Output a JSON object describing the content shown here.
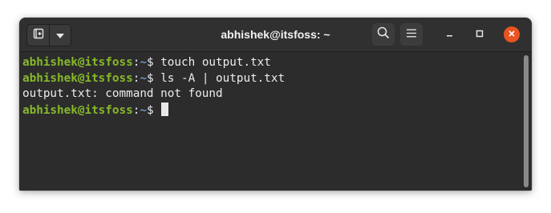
{
  "window": {
    "title": "abhishek@itsfoss: ~"
  },
  "icons": {
    "new_tab": "new-tab-icon",
    "menu_dropdown": "chevron-down-icon",
    "search": "search-icon",
    "hamburger": "hamburger-menu-icon",
    "minimize": "minimize-icon",
    "maximize": "maximize-icon",
    "close": "close-icon"
  },
  "colors": {
    "prompt_user": "#87b82a",
    "prompt_path": "#7095c4",
    "close_button": "#e95420",
    "background": "#2c2c2c"
  },
  "terminal": {
    "lines": [
      {
        "user": "abhishek@itsfoss",
        "sep": ":",
        "path": "~",
        "dollar": "$ ",
        "command": "touch output.txt"
      },
      {
        "user": "abhishek@itsfoss",
        "sep": ":",
        "path": "~",
        "dollar": "$ ",
        "command": "ls -A | output.txt"
      },
      {
        "output": "output.txt: command not found"
      },
      {
        "user": "abhishek@itsfoss",
        "sep": ":",
        "path": "~",
        "dollar": "$ ",
        "command": ""
      }
    ]
  }
}
